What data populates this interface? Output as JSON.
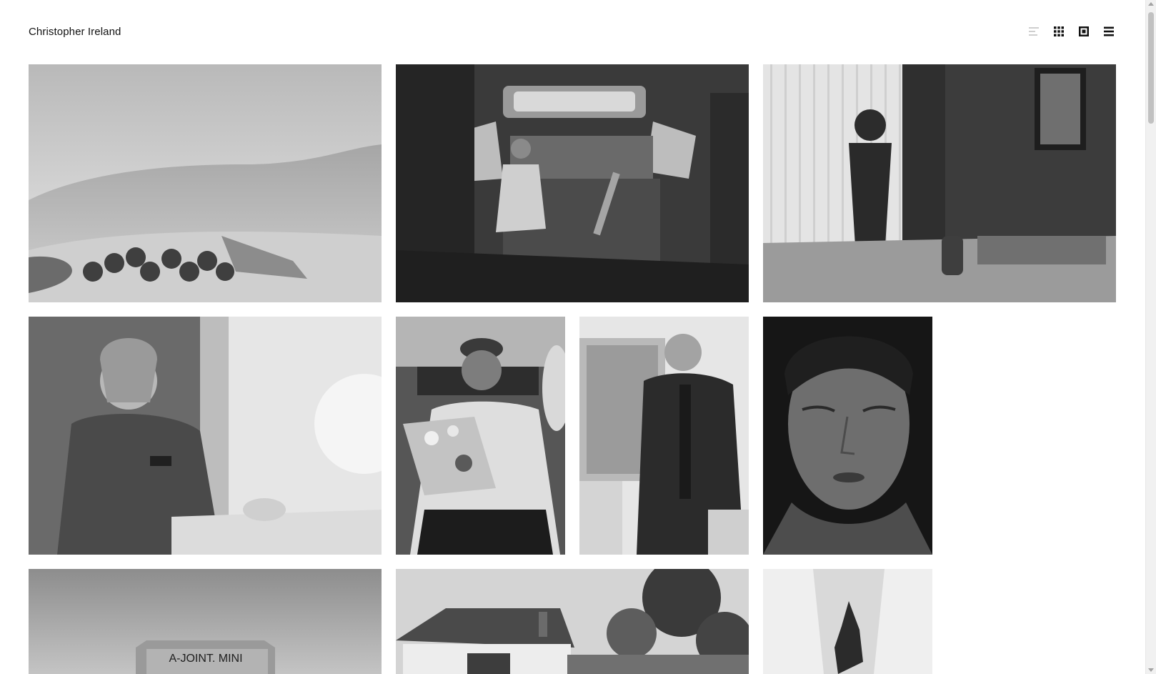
{
  "header": {
    "site_title": "Christopher Ireland"
  },
  "view_controls": [
    {
      "name": "list-view",
      "icon": "list-lines-icon",
      "active": false
    },
    {
      "name": "grid-view",
      "icon": "grid-dots-icon",
      "active": true
    },
    {
      "name": "single-view",
      "icon": "square-frame-icon",
      "active": true
    },
    {
      "name": "menu",
      "icon": "hamburger-menu-icon",
      "active": true
    }
  ],
  "gallery": {
    "tiles": [
      {
        "subject": "grass-field-rolls",
        "alt": ""
      },
      {
        "subject": "woman-in-car",
        "alt": ""
      },
      {
        "subject": "woman-at-window",
        "alt": ""
      },
      {
        "subject": "smiling-woman-uniform",
        "alt": ""
      },
      {
        "subject": "man-with-flowers",
        "alt": ""
      },
      {
        "subject": "bald-man-jacket",
        "alt": ""
      },
      {
        "subject": "woman-eyes-closed",
        "alt": ""
      },
      {
        "subject": "a-joint-mini-sign",
        "alt": ""
      },
      {
        "subject": "house-and-trees",
        "alt": ""
      },
      {
        "subject": "arm-tattoo",
        "alt": ""
      }
    ],
    "sign_text": "A-JOINT. MINI"
  },
  "colors": {
    "background": "#ffffff",
    "text": "#111111",
    "icon_active": "#111111",
    "icon_inactive": "#cfcfcf"
  }
}
